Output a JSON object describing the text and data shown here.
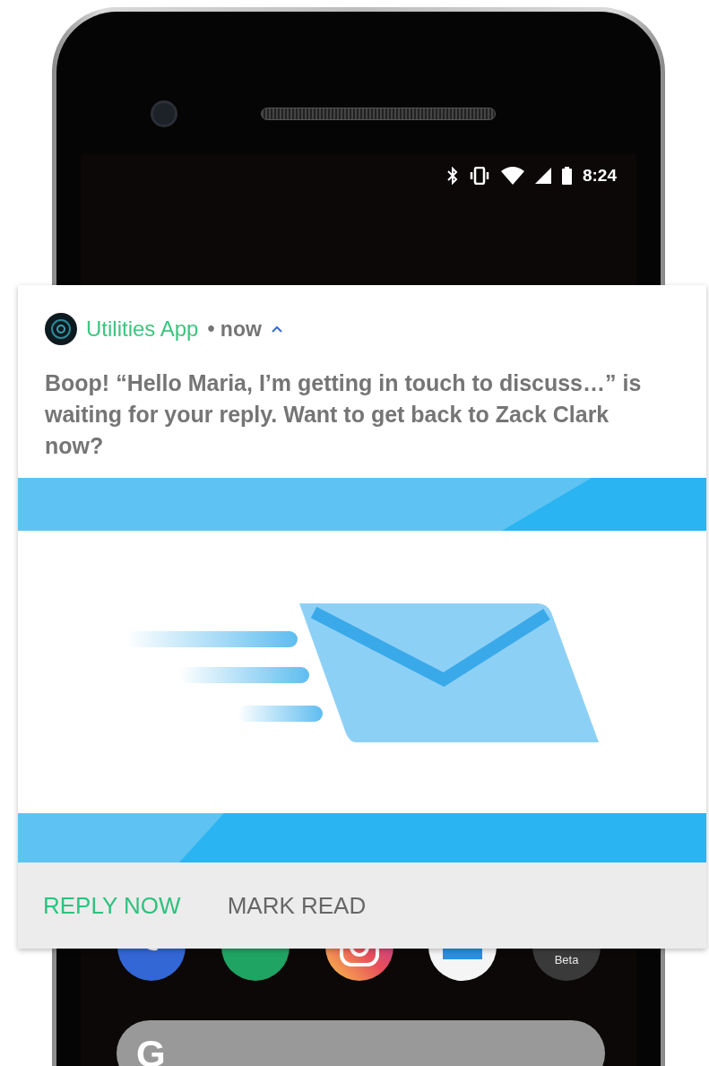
{
  "status_bar": {
    "time": "8:24"
  },
  "notification": {
    "app_name": "Utilities App",
    "separator": "•",
    "time": "now",
    "expanded": true,
    "message": "Boop! “Hello Maria, I’m getting in touch to discuss…” is waiting for your reply. Want to get back to Zack Clark now?",
    "actions": [
      {
        "label": "REPLY NOW",
        "kind": "primary"
      },
      {
        "label": "MARK READ",
        "kind": "secondary"
      }
    ]
  },
  "dock": [
    {
      "kind": "phone"
    },
    {
      "kind": "chat"
    },
    {
      "kind": "camera"
    },
    {
      "kind": "mail"
    },
    {
      "kind": "beta",
      "label": "Beta"
    }
  ],
  "search_bar": {
    "logo": "G"
  }
}
